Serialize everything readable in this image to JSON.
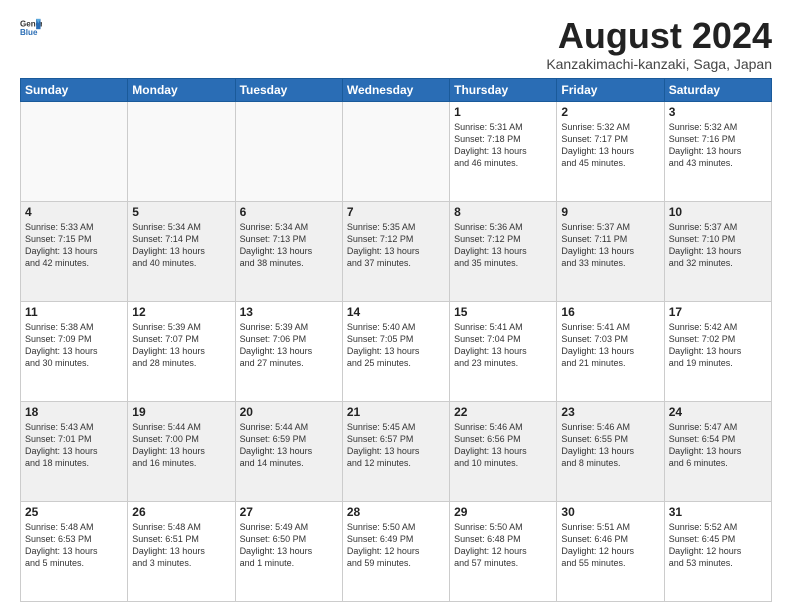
{
  "header": {
    "logo_general": "General",
    "logo_blue": "Blue",
    "title": "August 2024",
    "subtitle": "Kanzakimachi-kanzaki, Saga, Japan"
  },
  "weekdays": [
    "Sunday",
    "Monday",
    "Tuesday",
    "Wednesday",
    "Thursday",
    "Friday",
    "Saturday"
  ],
  "weeks": [
    [
      {
        "day": "",
        "text": "",
        "empty": true
      },
      {
        "day": "",
        "text": "",
        "empty": true
      },
      {
        "day": "",
        "text": "",
        "empty": true
      },
      {
        "day": "",
        "text": "",
        "empty": true
      },
      {
        "day": "1",
        "text": "Sunrise: 5:31 AM\nSunset: 7:18 PM\nDaylight: 13 hours\nand 46 minutes."
      },
      {
        "day": "2",
        "text": "Sunrise: 5:32 AM\nSunset: 7:17 PM\nDaylight: 13 hours\nand 45 minutes."
      },
      {
        "day": "3",
        "text": "Sunrise: 5:32 AM\nSunset: 7:16 PM\nDaylight: 13 hours\nand 43 minutes."
      }
    ],
    [
      {
        "day": "4",
        "text": "Sunrise: 5:33 AM\nSunset: 7:15 PM\nDaylight: 13 hours\nand 42 minutes.",
        "shaded": true
      },
      {
        "day": "5",
        "text": "Sunrise: 5:34 AM\nSunset: 7:14 PM\nDaylight: 13 hours\nand 40 minutes.",
        "shaded": true
      },
      {
        "day": "6",
        "text": "Sunrise: 5:34 AM\nSunset: 7:13 PM\nDaylight: 13 hours\nand 38 minutes.",
        "shaded": true
      },
      {
        "day": "7",
        "text": "Sunrise: 5:35 AM\nSunset: 7:12 PM\nDaylight: 13 hours\nand 37 minutes.",
        "shaded": true
      },
      {
        "day": "8",
        "text": "Sunrise: 5:36 AM\nSunset: 7:12 PM\nDaylight: 13 hours\nand 35 minutes.",
        "shaded": true
      },
      {
        "day": "9",
        "text": "Sunrise: 5:37 AM\nSunset: 7:11 PM\nDaylight: 13 hours\nand 33 minutes.",
        "shaded": true
      },
      {
        "day": "10",
        "text": "Sunrise: 5:37 AM\nSunset: 7:10 PM\nDaylight: 13 hours\nand 32 minutes.",
        "shaded": true
      }
    ],
    [
      {
        "day": "11",
        "text": "Sunrise: 5:38 AM\nSunset: 7:09 PM\nDaylight: 13 hours\nand 30 minutes."
      },
      {
        "day": "12",
        "text": "Sunrise: 5:39 AM\nSunset: 7:07 PM\nDaylight: 13 hours\nand 28 minutes."
      },
      {
        "day": "13",
        "text": "Sunrise: 5:39 AM\nSunset: 7:06 PM\nDaylight: 13 hours\nand 27 minutes."
      },
      {
        "day": "14",
        "text": "Sunrise: 5:40 AM\nSunset: 7:05 PM\nDaylight: 13 hours\nand 25 minutes."
      },
      {
        "day": "15",
        "text": "Sunrise: 5:41 AM\nSunset: 7:04 PM\nDaylight: 13 hours\nand 23 minutes."
      },
      {
        "day": "16",
        "text": "Sunrise: 5:41 AM\nSunset: 7:03 PM\nDaylight: 13 hours\nand 21 minutes."
      },
      {
        "day": "17",
        "text": "Sunrise: 5:42 AM\nSunset: 7:02 PM\nDaylight: 13 hours\nand 19 minutes."
      }
    ],
    [
      {
        "day": "18",
        "text": "Sunrise: 5:43 AM\nSunset: 7:01 PM\nDaylight: 13 hours\nand 18 minutes.",
        "shaded": true
      },
      {
        "day": "19",
        "text": "Sunrise: 5:44 AM\nSunset: 7:00 PM\nDaylight: 13 hours\nand 16 minutes.",
        "shaded": true
      },
      {
        "day": "20",
        "text": "Sunrise: 5:44 AM\nSunset: 6:59 PM\nDaylight: 13 hours\nand 14 minutes.",
        "shaded": true
      },
      {
        "day": "21",
        "text": "Sunrise: 5:45 AM\nSunset: 6:57 PM\nDaylight: 13 hours\nand 12 minutes.",
        "shaded": true
      },
      {
        "day": "22",
        "text": "Sunrise: 5:46 AM\nSunset: 6:56 PM\nDaylight: 13 hours\nand 10 minutes.",
        "shaded": true
      },
      {
        "day": "23",
        "text": "Sunrise: 5:46 AM\nSunset: 6:55 PM\nDaylight: 13 hours\nand 8 minutes.",
        "shaded": true
      },
      {
        "day": "24",
        "text": "Sunrise: 5:47 AM\nSunset: 6:54 PM\nDaylight: 13 hours\nand 6 minutes.",
        "shaded": true
      }
    ],
    [
      {
        "day": "25",
        "text": "Sunrise: 5:48 AM\nSunset: 6:53 PM\nDaylight: 13 hours\nand 5 minutes."
      },
      {
        "day": "26",
        "text": "Sunrise: 5:48 AM\nSunset: 6:51 PM\nDaylight: 13 hours\nand 3 minutes."
      },
      {
        "day": "27",
        "text": "Sunrise: 5:49 AM\nSunset: 6:50 PM\nDaylight: 13 hours\nand 1 minute."
      },
      {
        "day": "28",
        "text": "Sunrise: 5:50 AM\nSunset: 6:49 PM\nDaylight: 12 hours\nand 59 minutes."
      },
      {
        "day": "29",
        "text": "Sunrise: 5:50 AM\nSunset: 6:48 PM\nDaylight: 12 hours\nand 57 minutes."
      },
      {
        "day": "30",
        "text": "Sunrise: 5:51 AM\nSunset: 6:46 PM\nDaylight: 12 hours\nand 55 minutes."
      },
      {
        "day": "31",
        "text": "Sunrise: 5:52 AM\nSunset: 6:45 PM\nDaylight: 12 hours\nand 53 minutes."
      }
    ]
  ]
}
